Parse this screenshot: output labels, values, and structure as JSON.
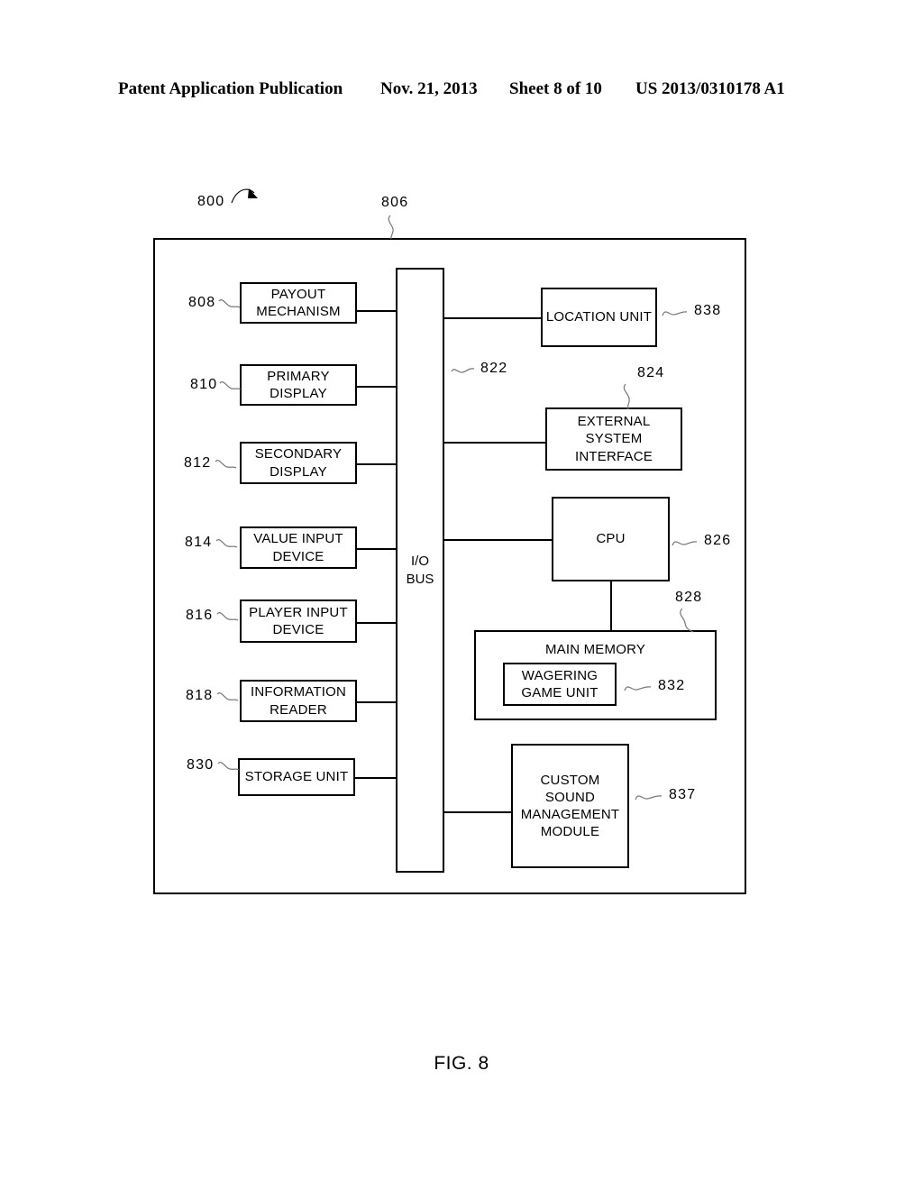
{
  "header": {
    "publication": "Patent Application Publication",
    "date": "Nov. 21, 2013",
    "sheet": "Sheet 8 of 10",
    "number": "US 2013/0310178 A1"
  },
  "figure": {
    "caption": "FIG. 8",
    "system_ref": "800",
    "frame_ref": "806",
    "bus_label": "I/O\nBUS",
    "bus_label_line1": "I/O",
    "bus_label_line2": "BUS",
    "bus_ref": "822"
  },
  "blocks": [
    {
      "id": "payout",
      "ref": "808",
      "label": "PAYOUT\nMECHANISM",
      "line1": "PAYOUT",
      "line2": "MECHANISM"
    },
    {
      "id": "primary",
      "ref": "810",
      "label": "PRIMARY\nDISPLAY",
      "line1": "PRIMARY",
      "line2": "DISPLAY"
    },
    {
      "id": "secondary",
      "ref": "812",
      "label": "SECONDARY\nDISPLAY",
      "line1": "SECONDARY",
      "line2": "DISPLAY"
    },
    {
      "id": "valueinput",
      "ref": "814",
      "label": "VALUE INPUT\nDEVICE",
      "line1": "VALUE INPUT",
      "line2": "DEVICE"
    },
    {
      "id": "playerinput",
      "ref": "816",
      "label": "PLAYER INPUT\nDEVICE",
      "line1": "PLAYER INPUT",
      "line2": "DEVICE"
    },
    {
      "id": "inforeader",
      "ref": "818",
      "label": "INFORMATION\nREADER",
      "line1": "INFORMATION",
      "line2": "READER"
    },
    {
      "id": "storage",
      "ref": "830",
      "label": "STORAGE UNIT",
      "line1": "STORAGE UNIT",
      "line2": ""
    },
    {
      "id": "location",
      "ref": "838",
      "label": "LOCATION UNIT",
      "line1": "LOCATION UNIT",
      "line2": ""
    },
    {
      "id": "external",
      "ref": "824",
      "label": "EXTERNAL\nSYSTEM\nINTERFACE",
      "line1": "EXTERNAL",
      "line2": "SYSTEM",
      "line3": "INTERFACE"
    },
    {
      "id": "cpu",
      "ref": "826",
      "label": "CPU",
      "line1": "CPU",
      "line2": ""
    },
    {
      "id": "mainmemory",
      "ref": "828",
      "label": "MAIN MEMORY",
      "line1": "MAIN MEMORY",
      "line2": ""
    },
    {
      "id": "wagering",
      "ref": "832",
      "label": "WAGERING\nGAME UNIT",
      "line1": "WAGERING",
      "line2": "GAME UNIT"
    },
    {
      "id": "sound",
      "ref": "837",
      "label": "CUSTOM\nSOUND\nMANAGEMENT\nMODULE",
      "line1": "CUSTOM",
      "line2": "SOUND",
      "line3": "MANAGEMENT",
      "line4": "MODULE"
    }
  ],
  "colors": {
    "ink": "#000000",
    "paper": "#ffffff"
  }
}
